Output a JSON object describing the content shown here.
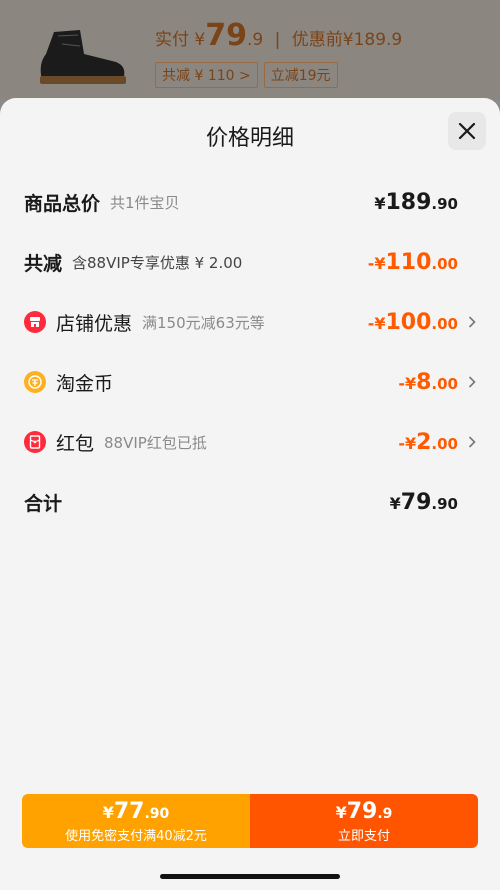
{
  "background": {
    "paid_label": "实付",
    "paid_yen": "¥",
    "paid_int": "79",
    "paid_dec": ".9",
    "separator": "|",
    "original_label": "优惠前",
    "original_price": "¥189.9",
    "tags": [
      "共减 ¥ 110 >",
      "立减19元"
    ]
  },
  "sheet": {
    "title": "价格明细",
    "close_icon": "close-icon"
  },
  "rows": {
    "total": {
      "label": "商品总价",
      "sub": "共1件宝贝",
      "yen": "¥",
      "int": "189",
      "dec": ".90"
    },
    "discount": {
      "label": "共减",
      "sub": "含88VIP专享优惠 ¥ 2.00",
      "yen": "-¥",
      "int": "110",
      "dec": ".00"
    },
    "shop": {
      "label": "店铺优惠",
      "sub": "满150元减63元等",
      "yen": "-¥",
      "int": "100",
      "dec": ".00",
      "icon": "shop-icon"
    },
    "coin": {
      "label": "淘金币",
      "sub": "",
      "yen": "-¥",
      "int": "8",
      "dec": ".00",
      "icon": "coin-icon"
    },
    "redpacket": {
      "label": "红包",
      "sub": "88VIP红包已抵",
      "yen": "-¥",
      "int": "2",
      "dec": ".00",
      "icon": "red-packet-icon"
    },
    "sum": {
      "label": "合计",
      "yen": "¥",
      "int": "79",
      "dec": ".90"
    }
  },
  "paybar": {
    "left": {
      "yen": "¥",
      "int": "77",
      "dec": ".90",
      "label": "使用免密支付满40减2元"
    },
    "right": {
      "yen": "¥",
      "int": "79",
      "dec": ".9",
      "label": "立即支付"
    }
  },
  "colors": {
    "accent": "#ff5500",
    "secondary": "#ffa200",
    "discount_text": "#ff5a00"
  }
}
